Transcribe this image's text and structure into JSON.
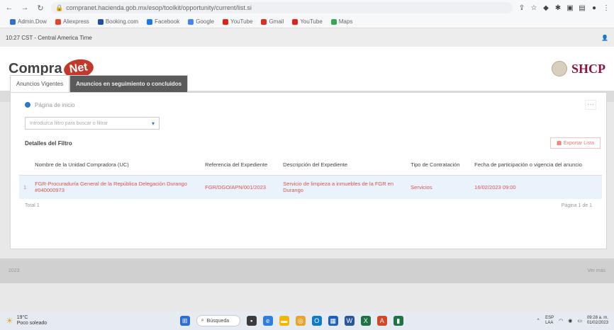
{
  "browser": {
    "url": "compranet.hacienda.gob.mx/esop/toolkit/opportunity/current/list.si",
    "bookmarks": [
      {
        "label": "Admin.Dow",
        "color": "#2f6fd6"
      },
      {
        "label": "Aliexpress",
        "color": "#e5452b"
      },
      {
        "label": "Booking.com",
        "color": "#1f4fa8"
      },
      {
        "label": "Facebook",
        "color": "#1877f2"
      },
      {
        "label": "Google",
        "color": "#4285f4"
      },
      {
        "label": "YouTube",
        "color": "#e62117"
      },
      {
        "label": "Gmail",
        "color": "#d93025"
      },
      {
        "label": "YouTube",
        "color": "#e62117"
      },
      {
        "label": "Maps",
        "color": "#34a853"
      }
    ]
  },
  "timebar": {
    "text": "10:27 CST - Central America Time"
  },
  "header": {
    "logo_part1": "Compra",
    "logo_part2": "Net",
    "agency": "SHCP"
  },
  "tabs": [
    {
      "label": "Anuncios Vigentes"
    },
    {
      "label": "Anuncios en seguimiento o concluidos"
    }
  ],
  "panel": {
    "radio_label": "Página de inicio",
    "select_placeholder": "Introduzca filtro para buscar o filtrar",
    "detail_title": "Detalles del Filtro",
    "export_label": "Exportar Lista",
    "columns": [
      "Nombre de la Unidad Compradora (UC)",
      "Referencia del Expediente",
      "Descripción del Expediente",
      "Tipo de Contratación",
      "Fecha de participación o vigencia del anuncio"
    ],
    "rows": [
      {
        "num": "1",
        "uc": "FGR-Procuraduría General de la República Delegación Durango #040000973",
        "ref": "FGR/DGO/APN/001/2023",
        "desc": "Servicio de limpieza a inmuebles de la FGR en Durango",
        "tipo": "Servicios",
        "fecha": "16/02/2023 09:00"
      }
    ],
    "total": "Total 1",
    "pagination": "Página 1 de 1"
  },
  "bottom": {
    "left": "2023",
    "right": "Ver más"
  },
  "taskbar": {
    "temp": "19°C",
    "weather": "Poco soleado",
    "search": "Búsqueda",
    "lang1": "ESP",
    "lang2": "LAA",
    "time": "09:28 a. m.",
    "date": "01/02/2023"
  }
}
